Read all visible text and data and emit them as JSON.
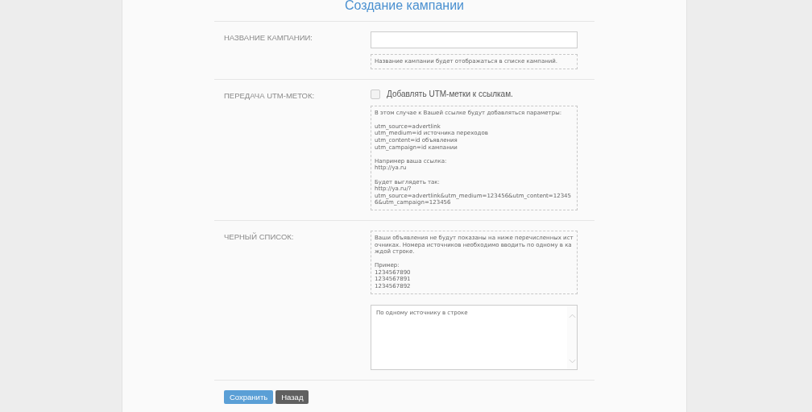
{
  "title": "Создание кампании",
  "sections": [
    {
      "kind": "text-input",
      "label": "НАЗВАНИЕ КАМПАНИИ:",
      "hint": [
        "Название кампании будет отображаться в списке кампаний."
      ]
    },
    {
      "kind": "checkbox",
      "label": "ПЕРЕДАЧА UTM-МЕТОК:",
      "checkbox": {
        "label": "Добавлять UTM-метки к ссылкам.",
        "checked": false
      },
      "hint": [
        "В этом случае к Вашей ссылке будут добавляться параметры:",
        "utm_source=advertlink\nutm_medium=id источника переходов\nutm_content=id объявления\nutm_campaign=id кампании",
        "Например ваша ссылка:\nhttp://ya.ru",
        "Будет выглядеть так:\nhttp://ya.ru/?\nutm_source=advertlink&utm_medium=123456&utm_content=123456&utm_campaign=123456"
      ]
    },
    {
      "kind": "textarea",
      "label": "ЧЕРНЫЙ СПИСОК:",
      "hint": [
        "Ваши объявления не будут показаны на ниже перечисленных источниках. Номера источников необходимо вводить по одному в каждой строке.",
        "Пример:\n1234567890\n1234567891\n1234567892"
      ],
      "placeholder": "По одному источнику в строке"
    }
  ],
  "buttons": [
    {
      "label": "Сохранить",
      "kind": "primary"
    },
    {
      "label": "Назад",
      "kind": "secondary"
    }
  ]
}
